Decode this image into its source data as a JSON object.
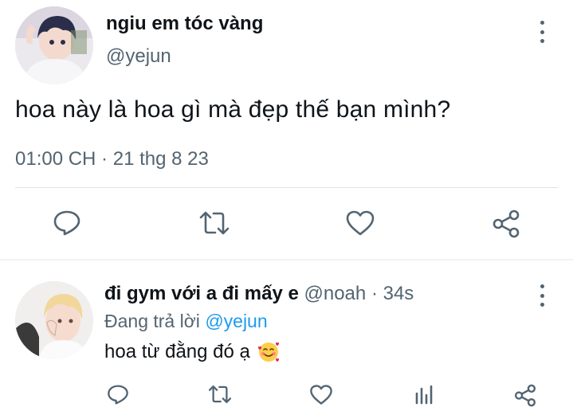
{
  "main_tweet": {
    "display_name": "ngiu em tóc vàng",
    "handle": "@yejun",
    "text": "hoa này là hoa gì mà đẹp thế bạn mình?",
    "timestamp": "01:00 CH · 21 thg 8 23",
    "actions": [
      "reply-icon",
      "retweet-icon",
      "like-icon",
      "share-icon"
    ]
  },
  "reply_tweet": {
    "display_name": "đi gym với a đi mấy e",
    "handle": "@noah",
    "separator": "·",
    "time": "34s",
    "replying_prefix": "Đang trả lời",
    "replying_to": "@yejun",
    "text": "hoa từ đằng đó ạ",
    "emoji": "smiling-face-with-hearts",
    "actions": [
      "reply-icon",
      "retweet-icon",
      "like-icon",
      "analytics-icon",
      "share-icon"
    ]
  },
  "colors": {
    "text_primary": "#0f1419",
    "text_secondary": "#536471",
    "accent": "#1d9bf0",
    "divider": "#dfe3e6"
  }
}
